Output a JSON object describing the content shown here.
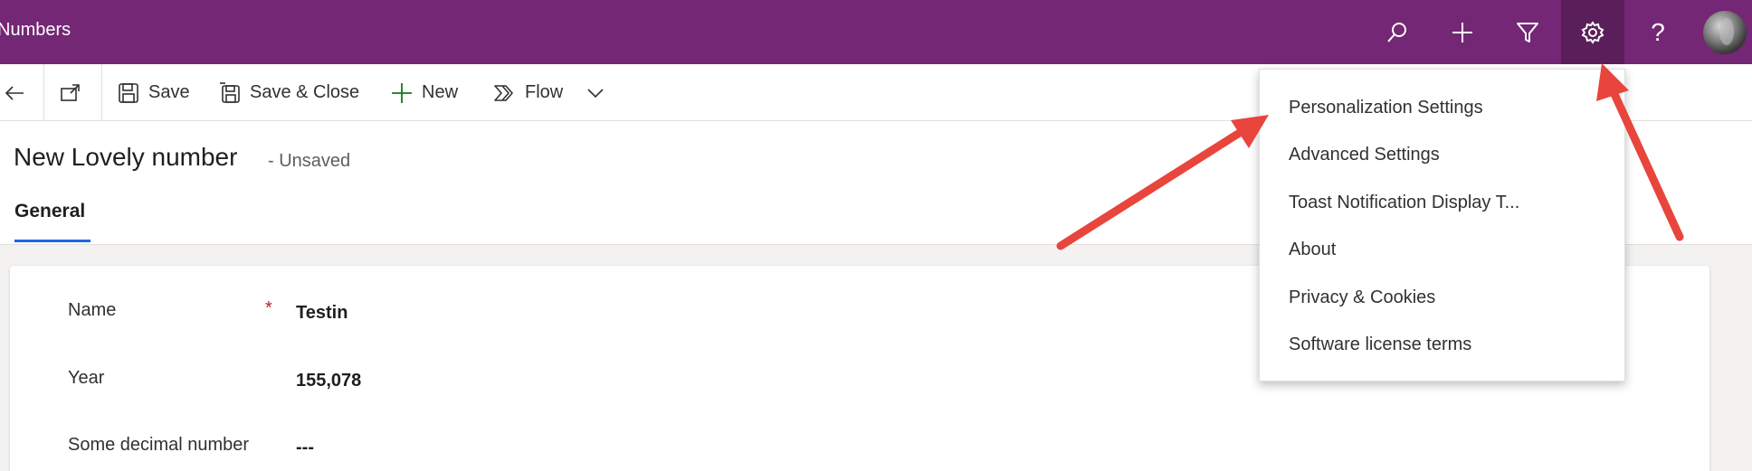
{
  "topbar": {
    "app_title": "Numbers",
    "icons": {
      "search": "search-icon",
      "new": "plus-icon",
      "filter": "filter-icon",
      "settings": "gear-icon",
      "help": "help-icon"
    },
    "help_glyph": "?",
    "accent_color": "#742774"
  },
  "toolbar": {
    "save_label": "Save",
    "save_close_label": "Save & Close",
    "new_label": "New",
    "flow_label": "Flow"
  },
  "header": {
    "title": "New Lovely number",
    "status": "- Unsaved",
    "tab_general": "General"
  },
  "form": {
    "fields": [
      {
        "label": "Name",
        "value": "Testin",
        "required": true,
        "required_mark": "*"
      },
      {
        "label": "Year",
        "value": "155,078",
        "required": false
      },
      {
        "label": "Some decimal number",
        "value": "---",
        "required": false
      }
    ]
  },
  "settings_menu": {
    "items": [
      "Personalization Settings",
      "Advanced Settings",
      "Toast Notification Display T...",
      "About",
      "Privacy & Cookies",
      "Software license terms"
    ]
  },
  "annotation": {
    "arrow_color": "#e8453c"
  }
}
